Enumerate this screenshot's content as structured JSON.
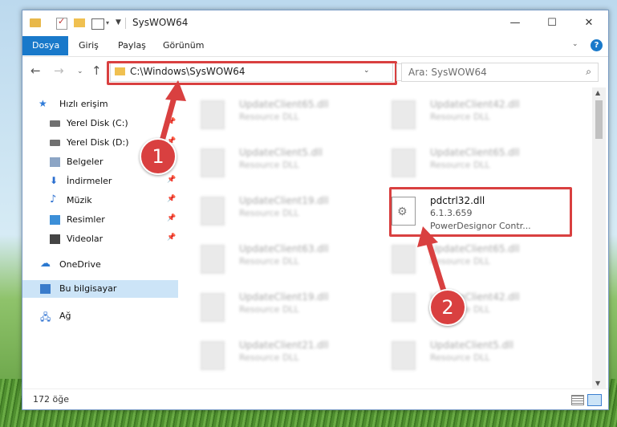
{
  "window": {
    "title": "SysWOW64",
    "controls": {
      "minimize": "—",
      "maximize": "☐",
      "close": "✕"
    }
  },
  "ribbon": {
    "tabs": [
      "Dosya",
      "Giriş",
      "Paylaş",
      "Görünüm"
    ],
    "help": "?"
  },
  "navigation": {
    "address": "C:\\Windows\\SysWOW64",
    "search_placeholder": "Ara: SysWOW64"
  },
  "sidebar": {
    "quick_access": "Hızlı erişim",
    "items": [
      {
        "label": "Yerel Disk (C:)",
        "icon": "disk-icon",
        "pinned": true
      },
      {
        "label": "Yerel Disk (D:)",
        "icon": "disk-icon",
        "pinned": true
      },
      {
        "label": "Belgeler",
        "icon": "documents-icon",
        "pinned": true
      },
      {
        "label": "İndirmeler",
        "icon": "download-icon",
        "pinned": true
      },
      {
        "label": "Müzik",
        "icon": "music-icon",
        "pinned": true
      },
      {
        "label": "Resimler",
        "icon": "pictures-icon",
        "pinned": true
      },
      {
        "label": "Videolar",
        "icon": "video-icon",
        "pinned": true
      }
    ],
    "onedrive": "OneDrive",
    "this_pc": "Bu bilgisayar",
    "network": "Ağ"
  },
  "files": [
    {
      "name": "UpdateClient65.dll",
      "desc": "Resource DLL"
    },
    {
      "name": "UpdateClient42.dll",
      "desc": "Resource DLL"
    },
    {
      "name": "UpdateClient5.dll",
      "desc": "Resource DLL"
    },
    {
      "name": "UpdateClient65.dll",
      "desc": "Resource DLL"
    },
    {
      "name": "UpdateClient19.dll",
      "desc": "Resource DLL"
    },
    {
      "name": "pdctrl32.dll",
      "version": "6.1.3.659",
      "desc": "PowerDesignor Contr..."
    },
    {
      "name": "UpdateClient63.dll",
      "desc": "Resource DLL"
    },
    {
      "name": "UpdateClient65.dll",
      "desc": "Resource DLL"
    },
    {
      "name": "UpdateClient19.dll",
      "desc": "Resource DLL"
    },
    {
      "name": "UpdateClient42.dll",
      "desc": "Resource DLL"
    },
    {
      "name": "UpdateClient21.dll",
      "desc": "Resource DLL"
    },
    {
      "name": "UpdateClient5.dll",
      "desc": "Resource DLL"
    }
  ],
  "status": {
    "count": "172 öğe"
  },
  "annotations": {
    "step1": "1",
    "step2": "2",
    "color": "#d94040"
  }
}
